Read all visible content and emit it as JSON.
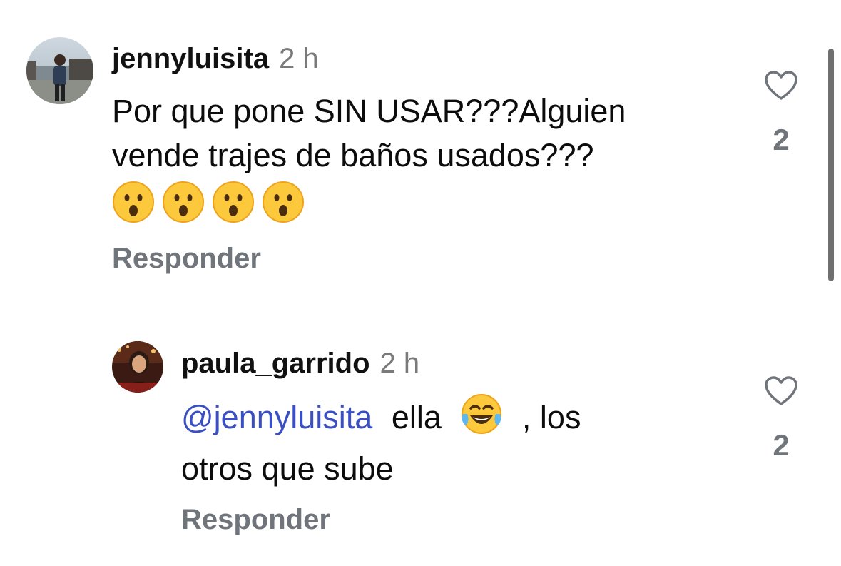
{
  "comments": [
    {
      "username": "jennyluisita",
      "time": "2 h",
      "text_line1": "Por que pone SIN USAR???Alguien",
      "text_line2": "vende trajes de baños usados???",
      "emojis": [
        "astonished-face",
        "astonished-face",
        "astonished-face",
        "astonished-face"
      ],
      "reply_label": "Responder",
      "likes": "2",
      "avatar": "photo-person-at-waterfront",
      "like_icon": "heart-outline-icon"
    },
    {
      "username": "paula_garrido",
      "time": "2 h",
      "mention": "@jennyluisita",
      "text_part1": "ella",
      "emoji": "face-with-tears-of-joy",
      "text_part2": ", los",
      "text_line2": "otros que sube",
      "reply_label": "Responder",
      "likes": "2",
      "avatar": "photo-woman-smiling",
      "like_icon": "heart-outline-icon"
    }
  ],
  "colors": {
    "mention": "#3a4fc1",
    "meta_gray": "#7a7a7a",
    "reply_gray": "#70757c",
    "scrollbar": "#6f6f6f"
  }
}
